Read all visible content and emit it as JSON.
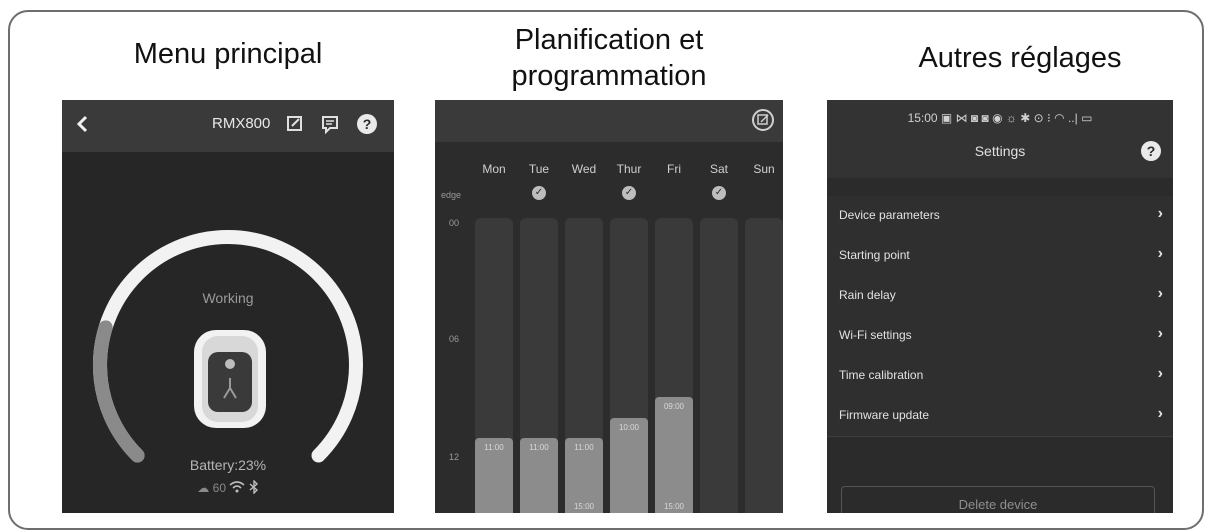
{
  "columns": [
    {
      "title": "Menu principal"
    },
    {
      "title": "Planification et programmation"
    },
    {
      "title": "Autres réglages"
    }
  ],
  "main_menu": {
    "device_name": "RMX800",
    "status": "Working",
    "battery": "Battery:23%",
    "battery_percent": 23,
    "signal_value": "60",
    "icons": [
      "back-icon",
      "edit-icon",
      "message-icon",
      "help-icon",
      "wifi-icon",
      "bluetooth-icon"
    ]
  },
  "schedule": {
    "days": [
      {
        "label": "Mon",
        "checked": false
      },
      {
        "label": "Tue",
        "checked": true
      },
      {
        "label": "Wed",
        "checked": false
      },
      {
        "label": "Thur",
        "checked": true
      },
      {
        "label": "Fri",
        "checked": false
      },
      {
        "label": "Sat",
        "checked": true
      },
      {
        "label": "Sun",
        "checked": false
      }
    ],
    "edge_label": "edge",
    "hour_labels": [
      "00",
      "06",
      "12"
    ],
    "bars": [
      {
        "start": "11:00",
        "end": ""
      },
      {
        "start": "11:00",
        "end": ""
      },
      {
        "start": "11:00",
        "end": "15:00"
      },
      {
        "start": "10:00",
        "end": ""
      },
      {
        "start": "09:00",
        "end": "15:00"
      },
      {
        "start": "",
        "end": ""
      },
      {
        "start": "",
        "end": ""
      }
    ]
  },
  "settings": {
    "status_bar": "15:00 ▣ ⋈ ◙   ◙ ◉ ☼ ✱ ⊙ ⁝ ◠ ..| ▭",
    "title": "Settings",
    "items": [
      {
        "label": "Device parameters"
      },
      {
        "label": "Starting point"
      },
      {
        "label": "Rain delay"
      },
      {
        "label": "Wi-Fi settings"
      },
      {
        "label": "Time calibration"
      },
      {
        "label": "Firmware update"
      }
    ],
    "delete_label": "Delete device"
  }
}
